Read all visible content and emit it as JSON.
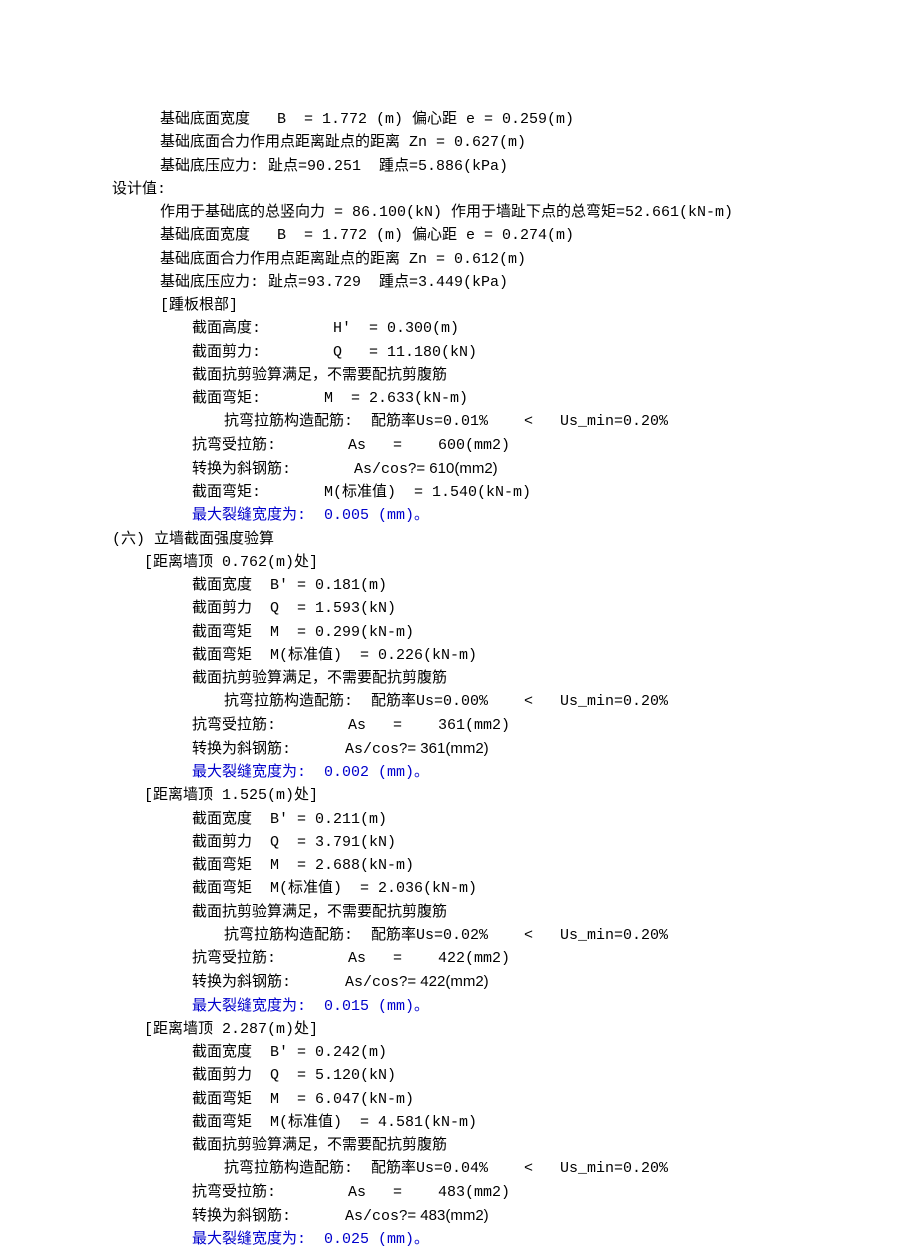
{
  "lines": [
    {
      "cls": "i1",
      "txt": "基础底面宽度   B  = 1.772 (m) 偏心距 e = 0.259(m)"
    },
    {
      "cls": "i1",
      "txt": "基础底面合力作用点距离趾点的距离 Zn = 0.627(m)"
    },
    {
      "cls": "i1",
      "txt": "基础底压应力: 趾点=90.251  踵点=5.886(kPa)"
    },
    {
      "cls": "i0",
      "txt": "设计值:"
    },
    {
      "cls": "i1",
      "txt": "作用于基础底的总竖向力 = 86.100(kN) 作用于墙趾下点的总弯矩=52.661(kN-m)"
    },
    {
      "cls": "i1",
      "txt": "基础底面宽度   B  = 1.772 (m) 偏心距 e = 0.274(m)"
    },
    {
      "cls": "i1",
      "txt": "基础底面合力作用点距离趾点的距离 Zn = 0.612(m)"
    },
    {
      "cls": "i1",
      "txt": "基础底压应力: 趾点=93.729  踵点=3.449(kPa)"
    },
    {
      "cls": "i1",
      "txt": "[踵板根部]"
    },
    {
      "cls": "i3",
      "txt": "截面高度:        H'  = 0.300(m)"
    },
    {
      "cls": "i3",
      "txt": "截面剪力:        Q   = 11.180(kN)"
    },
    {
      "cls": "i3",
      "txt": "截面抗剪验算满足，不需要配抗剪腹筋"
    },
    {
      "cls": "i3",
      "txt": "截面弯矩:       M  = 2.633(kN-m)"
    },
    {
      "cls": "i4",
      "txt": "抗弯拉筋构造配筋:  配筋率Us=0.01%    <   Us_min=0.20%"
    },
    {
      "cls": "i3",
      "txt": "抗弯受拉筋:        As   =    600(mm2)"
    },
    {
      "cls": "i3",
      "mix": true,
      "txt": "转换为斜钢筋:       As/cos?= 610(mm2)"
    },
    {
      "cls": "i3",
      "txt": "截面弯矩:       M(标准值)  = 1.540(kN-m)"
    },
    {
      "cls": "i3 blue",
      "txt": "最大裂缝宽度为:  0.005 (mm)。"
    },
    {
      "cls": "i0",
      "txt": "(六) 立墙截面强度验算"
    },
    {
      "cls": "i2",
      "txt": "[距离墙顶 0.762(m)处]"
    },
    {
      "cls": "i3",
      "txt": "截面宽度  B' = 0.181(m)"
    },
    {
      "cls": "i3",
      "txt": "截面剪力  Q  = 1.593(kN)"
    },
    {
      "cls": "i3",
      "txt": "截面弯矩  M  = 0.299(kN-m)"
    },
    {
      "cls": "i3",
      "txt": "截面弯矩  M(标准值)  = 0.226(kN-m)"
    },
    {
      "cls": "i3",
      "txt": "截面抗剪验算满足，不需要配抗剪腹筋"
    },
    {
      "cls": "i4",
      "txt": "抗弯拉筋构造配筋:  配筋率Us=0.00%    <   Us_min=0.20%"
    },
    {
      "cls": "i3",
      "txt": "抗弯受拉筋:        As   =    361(mm2)"
    },
    {
      "cls": "i3",
      "mix": true,
      "txt": "转换为斜钢筋:      As/cos?= 361(mm2)"
    },
    {
      "cls": "i3 blue",
      "txt": "最大裂缝宽度为:  0.002 (mm)。"
    },
    {
      "cls": "i2",
      "txt": "[距离墙顶 1.525(m)处]"
    },
    {
      "cls": "i3",
      "txt": "截面宽度  B' = 0.211(m)"
    },
    {
      "cls": "i3",
      "txt": "截面剪力  Q  = 3.791(kN)"
    },
    {
      "cls": "i3",
      "txt": "截面弯矩  M  = 2.688(kN-m)"
    },
    {
      "cls": "i3",
      "txt": "截面弯矩  M(标准值)  = 2.036(kN-m)"
    },
    {
      "cls": "i3",
      "txt": "截面抗剪验算满足，不需要配抗剪腹筋"
    },
    {
      "cls": "i4",
      "txt": "抗弯拉筋构造配筋:  配筋率Us=0.02%    <   Us_min=0.20%"
    },
    {
      "cls": "i3",
      "txt": "抗弯受拉筋:        As   =    422(mm2)"
    },
    {
      "cls": "i3",
      "mix": true,
      "txt": "转换为斜钢筋:      As/cos?= 422(mm2)"
    },
    {
      "cls": "i3 blue",
      "txt": "最大裂缝宽度为:  0.015 (mm)。"
    },
    {
      "cls": "i2",
      "txt": "[距离墙顶 2.287(m)处]"
    },
    {
      "cls": "i3",
      "txt": "截面宽度  B' = 0.242(m)"
    },
    {
      "cls": "i3",
      "txt": "截面剪力  Q  = 5.120(kN)"
    },
    {
      "cls": "i3",
      "txt": "截面弯矩  M  = 6.047(kN-m)"
    },
    {
      "cls": "i3",
      "txt": "截面弯矩  M(标准值)  = 4.581(kN-m)"
    },
    {
      "cls": "i3",
      "txt": "截面抗剪验算满足，不需要配抗剪腹筋"
    },
    {
      "cls": "i4",
      "txt": "抗弯拉筋构造配筋:  配筋率Us=0.04%    <   Us_min=0.20%"
    },
    {
      "cls": "i3",
      "txt": "抗弯受拉筋:        As   =    483(mm2)"
    },
    {
      "cls": "i3",
      "mix": true,
      "txt": "转换为斜钢筋:      As/cos?= 483(mm2)"
    },
    {
      "cls": "i3 blue",
      "txt": "最大裂缝宽度为:  0.025 (mm)。"
    }
  ]
}
